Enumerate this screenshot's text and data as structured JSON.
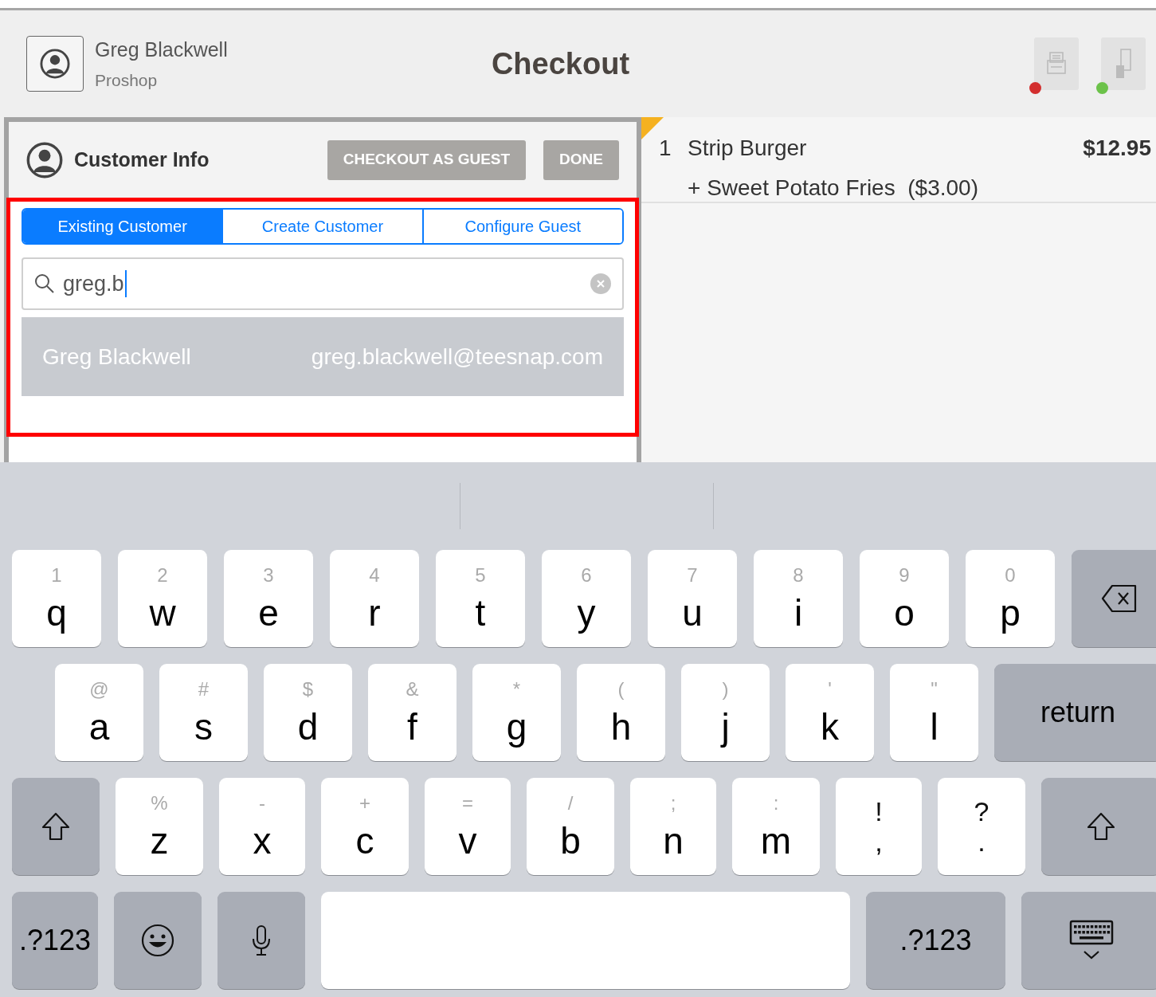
{
  "header": {
    "user_name": "Greg Blackwell",
    "location": "Proshop",
    "title": "Checkout",
    "devices": [
      {
        "kind": "printer",
        "color": "#d32f2f"
      },
      {
        "kind": "card_reader",
        "color": "#6cc24a"
      }
    ]
  },
  "customer_panel": {
    "title": "Customer Info",
    "buttons": [
      "CHECKOUT AS GUEST",
      "DONE"
    ],
    "tabs": [
      {
        "label": "Existing Customer",
        "selected": true
      },
      {
        "label": "Create Customer",
        "selected": false
      },
      {
        "label": "Configure Guest",
        "selected": false
      }
    ],
    "search": {
      "value": "greg.b"
    },
    "results": [
      {
        "name": "Greg Blackwell",
        "email": "greg.blackwell@teesnap.com"
      }
    ]
  },
  "order": {
    "items": [
      {
        "qty": "1",
        "name": "Strip Burger",
        "price": "$12.95",
        "modifiers": [
          "+ Sweet Potato Fries  ($3.00)"
        ]
      }
    ]
  },
  "keyboard": {
    "key_rows": [
      {
        "keys": [
          {
            "kind": "letter",
            "hint": "1",
            "label": "q"
          },
          {
            "kind": "letter",
            "hint": "2",
            "label": "w"
          },
          {
            "kind": "letter",
            "hint": "3",
            "label": "e"
          },
          {
            "kind": "letter",
            "hint": "4",
            "label": "r"
          },
          {
            "kind": "letter",
            "hint": "5",
            "label": "t"
          },
          {
            "kind": "letter",
            "hint": "6",
            "label": "y"
          },
          {
            "kind": "letter",
            "hint": "7",
            "label": "u"
          },
          {
            "kind": "letter",
            "hint": "8",
            "label": "i"
          },
          {
            "kind": "letter",
            "hint": "9",
            "label": "o"
          },
          {
            "kind": "letter",
            "hint": "0",
            "label": "p"
          },
          {
            "kind": "backspace"
          }
        ]
      },
      {
        "keys": [
          {
            "kind": "letter",
            "hint": "@",
            "label": "a"
          },
          {
            "kind": "letter",
            "hint": "#",
            "label": "s"
          },
          {
            "kind": "letter",
            "hint": "$",
            "label": "d"
          },
          {
            "kind": "letter",
            "hint": "&",
            "label": "f"
          },
          {
            "kind": "letter",
            "hint": "*",
            "label": "g"
          },
          {
            "kind": "letter",
            "hint": "(",
            "label": "h"
          },
          {
            "kind": "letter",
            "hint": ")",
            "label": "j"
          },
          {
            "kind": "letter",
            "hint": "'",
            "label": "k"
          },
          {
            "kind": "letter",
            "hint": "\"",
            "label": "l"
          },
          {
            "kind": "action",
            "label": "return"
          }
        ]
      },
      {
        "keys": [
          {
            "kind": "shift"
          },
          {
            "kind": "letter",
            "hint": "%",
            "label": "z"
          },
          {
            "kind": "letter",
            "hint": "-",
            "label": "x"
          },
          {
            "kind": "letter",
            "hint": "+",
            "label": "c"
          },
          {
            "kind": "letter",
            "hint": "=",
            "label": "v"
          },
          {
            "kind": "letter",
            "hint": "/",
            "label": "b"
          },
          {
            "kind": "letter",
            "hint": ";",
            "label": "n"
          },
          {
            "kind": "letter",
            "hint": ":",
            "label": "m"
          },
          {
            "kind": "punct",
            "hint": "!",
            "label": ","
          },
          {
            "kind": "punct",
            "hint": "?",
            "label": "."
          },
          {
            "kind": "shift"
          }
        ]
      },
      {
        "keys": [
          {
            "kind": "action",
            "label": ".?123"
          },
          {
            "kind": "emoji"
          },
          {
            "kind": "mic"
          },
          {
            "kind": "space"
          },
          {
            "kind": "action",
            "label": ".?123"
          },
          {
            "kind": "hide"
          }
        ]
      }
    ]
  }
}
